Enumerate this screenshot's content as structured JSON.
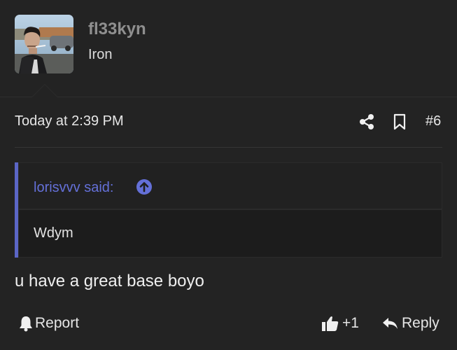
{
  "author": {
    "username": "fl33kyn",
    "title": "Iron",
    "avatar_icon": "user-avatar-photo"
  },
  "post": {
    "date": "Today at 2:39 PM",
    "number": "#6",
    "message": "u have a great base boyo"
  },
  "quote": {
    "author": "lorisvvv said:",
    "text": "Wdym",
    "accent_color": "#5b66c6"
  },
  "actions": {
    "share_icon": "share-icon",
    "bookmark_icon": "bookmark-icon",
    "report_label": "Report",
    "like_label": "+1",
    "reply_label": "Reply"
  }
}
